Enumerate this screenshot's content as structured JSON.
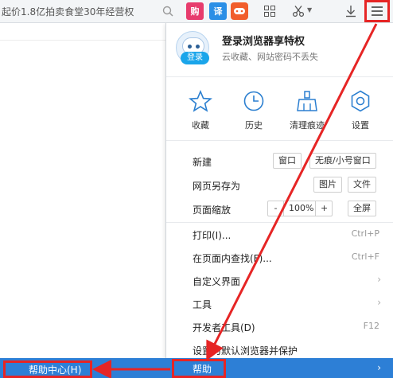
{
  "toolbar": {
    "address_text": "起价1.8亿拍卖食堂30年经营权",
    "icons": [
      "search-icon",
      "shopping-icon",
      "translate-icon",
      "game-icon",
      "apps-grid-icon",
      "scissors-icon",
      "download-icon",
      "menu-icon"
    ],
    "gou_label": "购",
    "yi_label": "译"
  },
  "login": {
    "title": "登录浏览器享特权",
    "subtitle": "云收藏、网站密码不丢失",
    "button": "登录"
  },
  "quick_actions": [
    {
      "label": "收藏",
      "icon": "star-icon"
    },
    {
      "label": "历史",
      "icon": "clock-icon"
    },
    {
      "label": "清理痕迹",
      "icon": "broom-icon"
    },
    {
      "label": "设置",
      "icon": "gear-icon"
    }
  ],
  "menu": {
    "new": {
      "label": "新建",
      "window": "窗口",
      "incognito": "无痕/小号窗口"
    },
    "save_as": {
      "label": "网页另存为",
      "image": "图片",
      "file": "文件"
    },
    "zoom": {
      "label": "页面缩放",
      "minus": "-",
      "value": "100%",
      "plus": "+",
      "fullscreen": "全屏"
    },
    "print": {
      "label": "打印(I)...",
      "shortcut": "Ctrl+P"
    },
    "find": {
      "label": "在页面内查找(F)...",
      "shortcut": "Ctrl+F"
    },
    "customize": {
      "label": "自定义界面"
    },
    "tools": {
      "label": "工具"
    },
    "devtools": {
      "label": "开发者工具(D)",
      "shortcut": "F12"
    },
    "default_browser": {
      "label": "设置为默认浏览器并保护"
    },
    "help": {
      "label": "帮助"
    }
  },
  "submenu": {
    "help_center": "帮助中心(H)"
  },
  "colors": {
    "highlight": "#2d7fd6",
    "annotation_red": "#e62525",
    "accent_blue": "#1aa5ea"
  }
}
